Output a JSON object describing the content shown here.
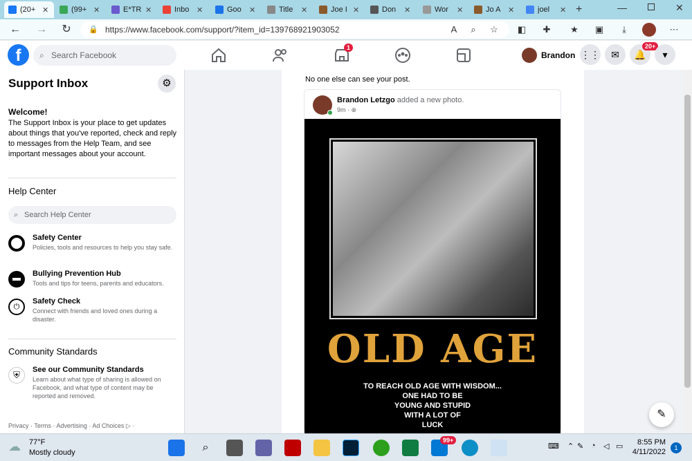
{
  "browser": {
    "tabs": [
      {
        "label": "(20+",
        "color": "#1877f2",
        "active": true
      },
      {
        "label": "(99+",
        "color": "#3aa757"
      },
      {
        "label": "E*TR",
        "color": "#6a5acd"
      },
      {
        "label": "Inbo",
        "color": "#ea4335"
      },
      {
        "label": "Goo",
        "color": "#1a73e8"
      },
      {
        "label": "Title",
        "color": "#888888"
      },
      {
        "label": "Joe I",
        "color": "#8b5a2b"
      },
      {
        "label": "Don",
        "color": "#555555"
      },
      {
        "label": "Wor",
        "color": "#999999"
      },
      {
        "label": "Jo A",
        "color": "#8b5a2b"
      },
      {
        "label": "joel",
        "color": "#4285f4"
      }
    ],
    "url": "https://www.facebook.com/support/?item_id=139768921903052"
  },
  "header": {
    "search_placeholder": "Search Facebook",
    "user_name": "Brandon",
    "marketplace_badge": "1",
    "notifications_badge": "20+"
  },
  "sidebar": {
    "title": "Support Inbox",
    "welcome_heading": "Welcome!",
    "welcome_text": "The Support Inbox is your place to get updates about things that you've reported, check and reply to messages from the Help Team, and see important messages about your account.",
    "help_center_heading": "Help Center",
    "help_search_placeholder": "Search Help Center",
    "items": [
      {
        "title": "Safety Center",
        "desc": "Policies, tools and resources to help you stay safe."
      },
      {
        "title": "Bullying Prevention Hub",
        "desc": "Tools and tips for teens, parents and educators."
      },
      {
        "title": "Safety Check",
        "desc": "Connect with friends and loved ones during a disaster."
      }
    ],
    "community_heading": "Community Standards",
    "community_item": {
      "title": "See our Community Standards",
      "desc": "Learn about what type of sharing is allowed on Facebook, and what type of content may be reported and removed."
    },
    "footer": "Privacy · Terms · Advertising · Ad Choices ▷ ·"
  },
  "main": {
    "privacy_note": "No one else can see your post.",
    "post": {
      "author": "Brandon Letzgo",
      "action": " added a new photo.",
      "time": "9m ·",
      "poster_title": "OLD AGE",
      "poster_lines": [
        "TO REACH OLD AGE WITH WISDOM...",
        "ONE HAD TO BE",
        "YOUNG AND STUPID",
        "WITH A LOT OF",
        "LUCK"
      ]
    }
  },
  "taskbar": {
    "weather_temp": "77°F",
    "weather_desc": "Mostly cloudy",
    "time": "8:55 PM",
    "date": "4/11/2022",
    "notif_count": "1",
    "app_badge": "99+"
  }
}
